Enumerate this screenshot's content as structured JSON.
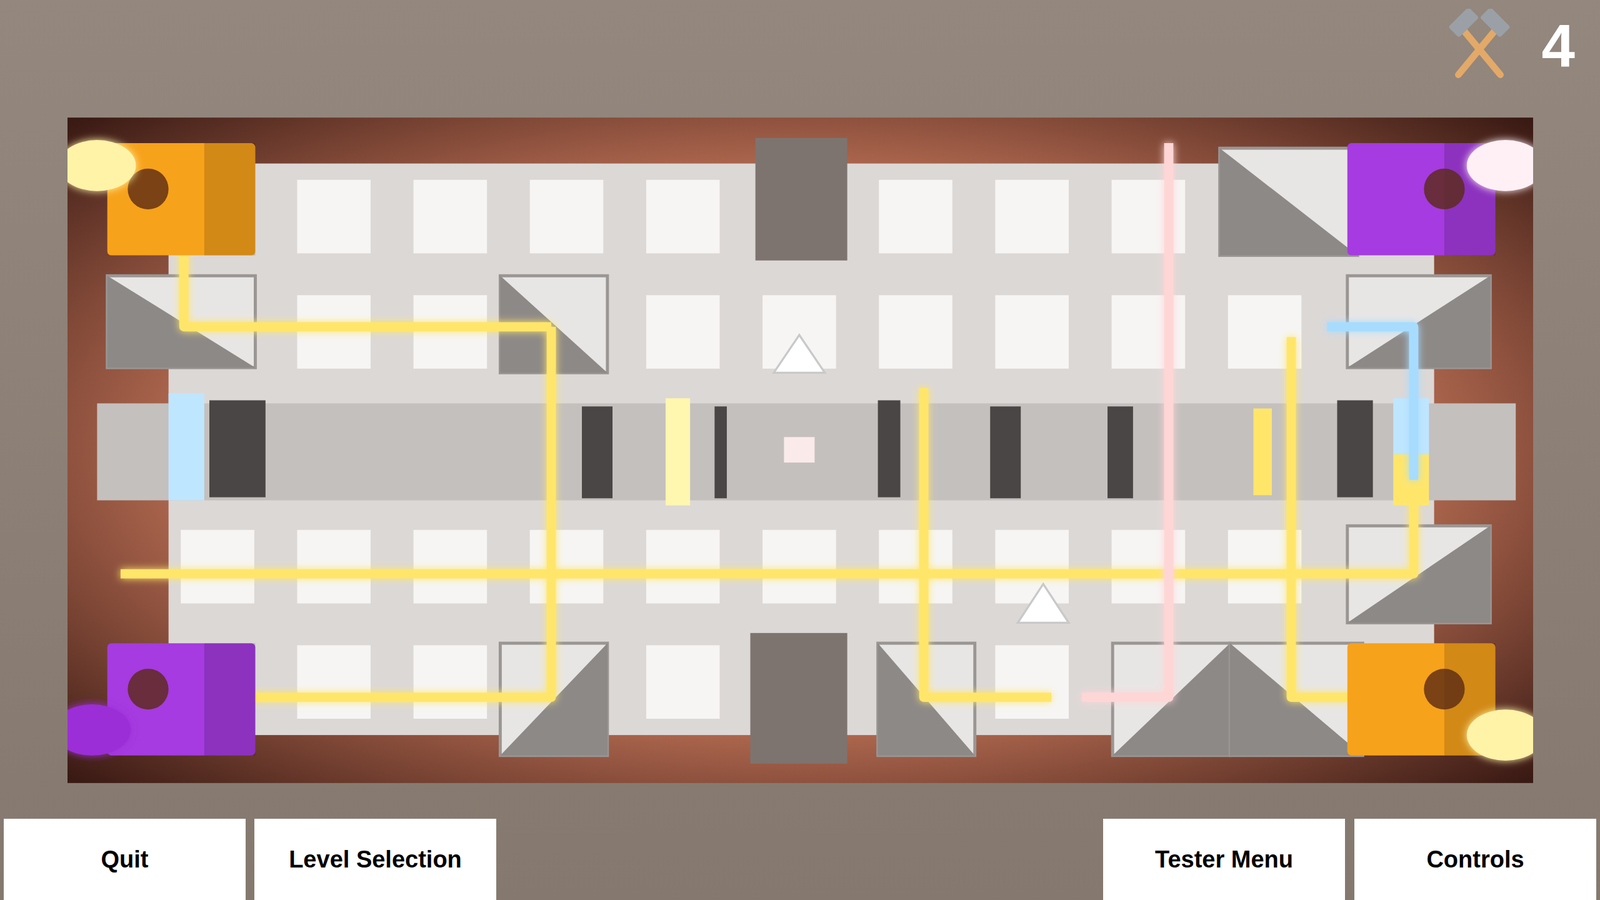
{
  "counter": {
    "value": "4"
  },
  "buttons_left": [
    {
      "label": "Quit"
    },
    {
      "label": "Level Selection"
    }
  ],
  "buttons_right": [
    {
      "label": "Tester Menu"
    },
    {
      "label": "Controls"
    }
  ],
  "emitters": [
    {
      "color": "#f7a21b",
      "bulb_color": "#fff3a8"
    },
    {
      "color": "#a53be0",
      "bulb_color": "#fff0f6"
    },
    {
      "color": "#a53be0",
      "bulb_color": "#9b2fd6"
    },
    {
      "color": "#f7a21b",
      "bulb_color": "#fff3a8"
    }
  ],
  "beams": [
    {
      "color": "#ffe66b"
    },
    {
      "color": "#fff1f1"
    },
    {
      "color": "#ffe66b"
    },
    {
      "color": "#ffd0d0"
    },
    {
      "color": "#ffe66b"
    },
    {
      "color": "#a8dcff"
    },
    {
      "color": "#ffe66b"
    },
    {
      "color": "#fff6f6"
    },
    {
      "color": "#ffe66b"
    },
    {
      "color": "#ffd6d6"
    },
    {
      "color": "#ffe66b"
    },
    {
      "color": "#fff6f6"
    },
    {
      "color": "#fff6f6"
    },
    {
      "color": "#ffc4c4"
    }
  ]
}
